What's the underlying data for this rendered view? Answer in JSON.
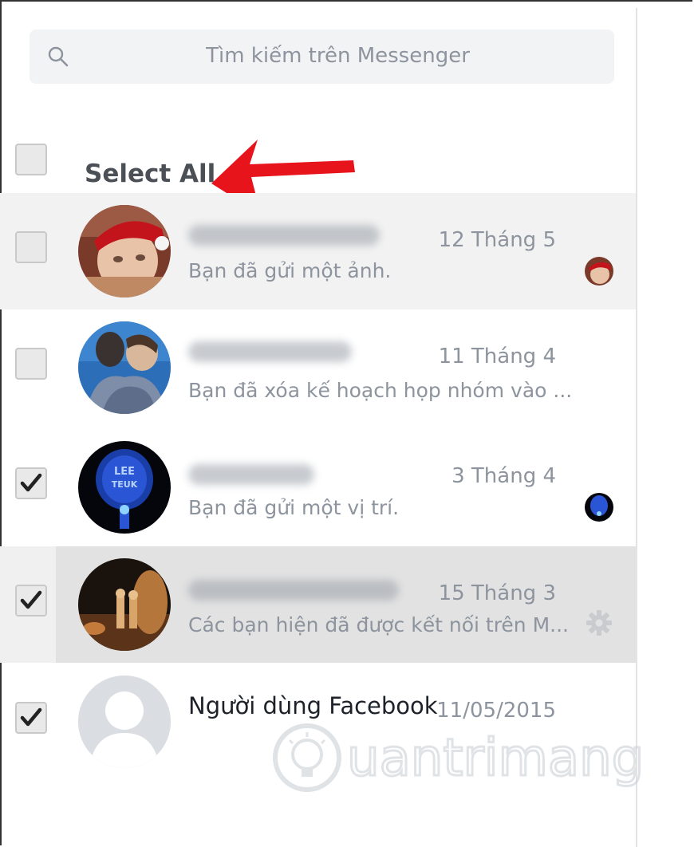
{
  "search": {
    "placeholder": "Tìm kiếm trên Messenger",
    "icon": "search-icon"
  },
  "select_all": {
    "label": "Select All",
    "checked": false
  },
  "conversations": [
    {
      "name_blurred": true,
      "date": "12 Tháng 5",
      "snippet": "Bạn đã gửi một ảnh.",
      "checked": false,
      "read_receipt": true
    },
    {
      "name_blurred": true,
      "date": "11 Tháng 4",
      "snippet": "Bạn đã xóa kế hoạch họp nhóm vào ...",
      "checked": false,
      "read_receipt": false
    },
    {
      "name_blurred": true,
      "date": "3 Tháng 4",
      "snippet": "Bạn đã gửi một vị trí.",
      "checked": true,
      "read_receipt": true
    },
    {
      "name_blurred": true,
      "date": "15 Tháng 3",
      "snippet": "Các bạn hiện đã được kết nối trên M...",
      "checked": true,
      "has_settings": true
    },
    {
      "name": "Người dùng Facebook",
      "date": "11/05/2015",
      "checked": true
    }
  ],
  "watermark": "uantrimang",
  "colors": {
    "arrow": "#e8141b",
    "hover_row": "#e2e2e2",
    "selected_row": "#f2f2f2",
    "muted_text": "#8d949e"
  }
}
